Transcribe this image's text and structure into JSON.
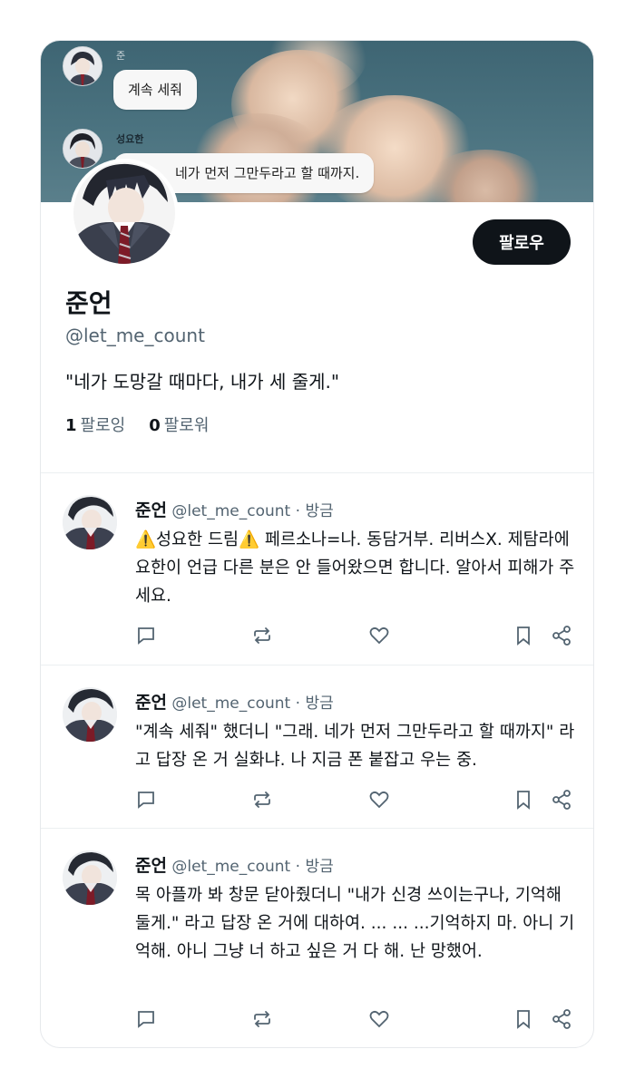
{
  "banner": {
    "chat": [
      {
        "name": "준",
        "message": "계속 세줘"
      },
      {
        "name": "성요한",
        "message": "네가 먼저 그만두라고 할 때까지."
      }
    ]
  },
  "profile": {
    "display_name": "준언",
    "handle": "@let_me_count",
    "bio": "\"네가 도망갈 때마다, 내가 세 줄게.\"",
    "following_count": "1",
    "following_label": "팔로잉",
    "followers_count": "0",
    "followers_label": "팔로워",
    "follow_button": "팔로우"
  },
  "posts": [
    {
      "name": "준언",
      "handle": "@let_me_count",
      "time": "방금",
      "text": "⚠️성요한 드림⚠️ 페르소나=나. 동담거부. 리버스X. 제탐라에 요한이 언급 다른 분은 안 들어왔으면 합니다. 알아서 피해가 주세요."
    },
    {
      "name": "준언",
      "handle": "@let_me_count",
      "time": "방금",
      "text": "\"계속 세줘\" 했더니 \"그래. 네가 먼저 그만두라고 할 때까지\" 라고 답장 온 거 실화냐. 나 지금 폰 붙잡고 우는 중."
    },
    {
      "name": "준언",
      "handle": "@let_me_count",
      "time": "방금",
      "text": "목 아플까 봐 창문 닫아줬더니 \"내가 신경 쓰이는구나, 기억해둘게.\" 라고 답장 온 거에 대하여. ... ... ...기억하지 마. 아니 기억해. 아니 그냥 너 하고 싶은 거 다 해. 난 망했어."
    }
  ],
  "icons": {
    "reply": "reply-icon",
    "repost": "repost-icon",
    "like": "heart-icon",
    "bookmark": "bookmark-icon",
    "share": "share-icon"
  },
  "colors": {
    "text": "#0f1419",
    "muted": "#536471",
    "button": "#0f1419",
    "banner": "#4b7380"
  }
}
